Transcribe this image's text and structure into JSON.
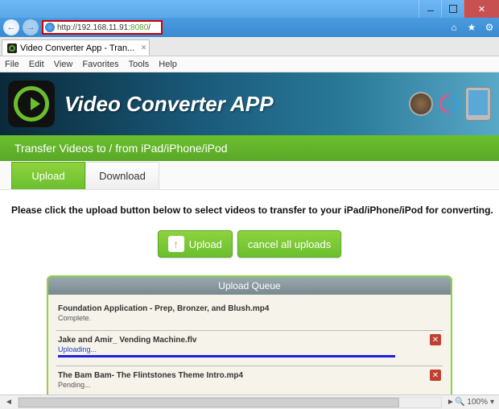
{
  "browser": {
    "url_prefix": "http://192.168.11.91:",
    "url_port": "8080",
    "url_suffix": "/",
    "tab_title": "Video Converter App - Tran...",
    "menu": [
      "File",
      "Edit",
      "View",
      "Favorites",
      "Tools",
      "Help"
    ],
    "zoom": "100%"
  },
  "page": {
    "banner_title": "Video Converter APP",
    "subheader": "Transfer Videos to / from iPad/iPhone/iPod",
    "tabs": {
      "upload": "Upload",
      "download": "Download"
    },
    "instruction": "Please click the upload button below to select videos to transfer to your iPad/iPhone/iPod for converting.",
    "upload_btn": "Upload",
    "cancel_btn": "cancel all uploads",
    "queue_header": "Upload Queue",
    "queue": [
      {
        "name": "Foundation Application - Prep, Bronzer, and Blush.mp4",
        "status": "Complete.",
        "state": "complete"
      },
      {
        "name": "Jake and Amir_ Vending Machine.flv",
        "status": "Uploading...",
        "state": "uploading"
      },
      {
        "name": "The Bam Bam- The Flintstones Theme Intro.mp4",
        "status": "Pending...",
        "state": "pending"
      }
    ]
  }
}
